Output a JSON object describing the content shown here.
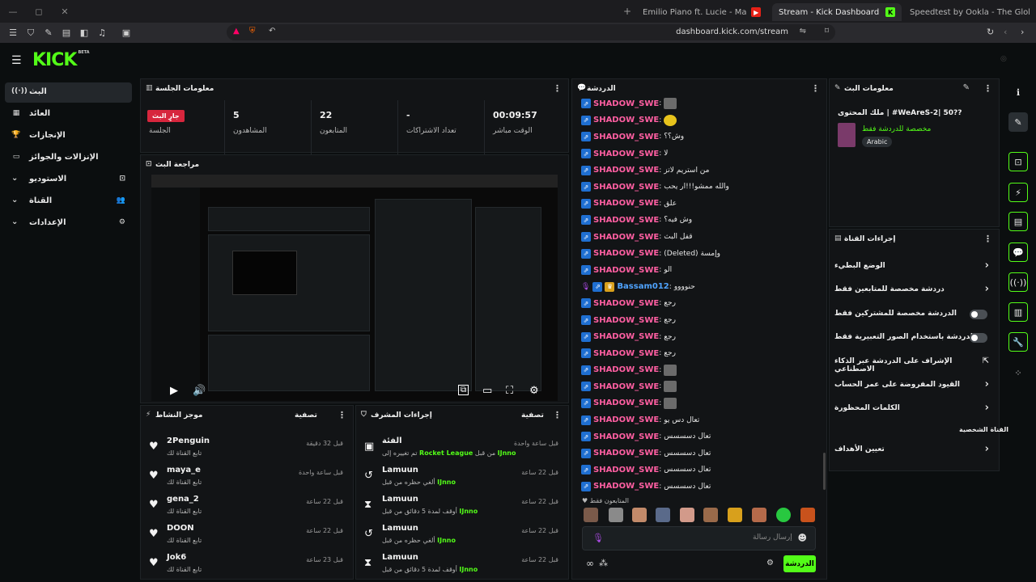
{
  "browser": {
    "tabs": [
      {
        "label": "Emilio Piano ft. Lucie - Maison - YouT",
        "fav": "▶"
      },
      {
        "label": "Stream - Kick Dashboard",
        "fav": "K"
      },
      {
        "label": "Speedtest by Ookla - The Global Broa",
        "fav": ""
      }
    ],
    "url": "dashboard.kick.com/stream"
  },
  "app": {
    "logo": "KICK",
    "beta": "BETA"
  },
  "nav": {
    "items": [
      {
        "label": "البث",
        "icon": "((·))"
      },
      {
        "label": "العائد",
        "icon": "▦"
      },
      {
        "label": "الإنجازات",
        "icon": "🏆"
      },
      {
        "label": "الإنزالات والجوائز",
        "icon": "▭"
      },
      {
        "label": "الاستوديو",
        "icon": "⊡"
      },
      {
        "label": "القناة",
        "icon": "👥"
      },
      {
        "label": "الإعدادات",
        "icon": "⚙"
      }
    ]
  },
  "session": {
    "title": "معلومات الجلسة",
    "live_badge": "جارٍ البث",
    "session_label": "الجلسة",
    "stats": [
      {
        "value": "5",
        "label": "المشاهدون"
      },
      {
        "value": "22",
        "label": "المتابعون"
      },
      {
        "value": "-",
        "label": "تعداد الاشتراكات"
      },
      {
        "value": "00:09:57",
        "label": "الوقت مباشر"
      }
    ]
  },
  "preview": {
    "title": "مراجعة البث"
  },
  "activity": {
    "title": "موجز النشاط",
    "filter": "تصفية",
    "items": [
      {
        "name": "2Penguin",
        "sub": "تابع القناة لك",
        "time": "قبل 32 دقيقة"
      },
      {
        "name": "maya_e",
        "sub": "تابع القناة لك",
        "time": "قبل ساعة واحدة"
      },
      {
        "name": "gena_2",
        "sub": "تابع القناة لك",
        "time": "قبل 22 ساعة"
      },
      {
        "name": "DOON",
        "sub": "تابع القناة لك",
        "time": "قبل 22 ساعة"
      },
      {
        "name": "Jok6",
        "sub": "تابع القناة لك",
        "time": "قبل 23 ساعة"
      }
    ]
  },
  "modactions": {
    "title": "إجراءات المشرف",
    "filter": "تصفية",
    "items": [
      {
        "icon": "▣",
        "name": "الفئة",
        "sub_pre": "تم تغييره إلى",
        "sub_hl": "Rocket League",
        "sub_mid": "من قبل",
        "sub_user": "IJnno",
        "time": "قبل ساعة واحدة"
      },
      {
        "icon": "↺",
        "name": "Lamuun",
        "sub_pre": "ألغي حظره من قبل",
        "sub_hl": "",
        "sub_mid": "",
        "sub_user": "IJnno",
        "time": "قبل 22 ساعة"
      },
      {
        "icon": "⧗",
        "name": "Lamuun",
        "sub_pre": "أوقف لمدة 5 دقائق من قبل",
        "sub_hl": "",
        "sub_mid": "",
        "sub_user": "IJnno",
        "time": "قبل 22 ساعة"
      },
      {
        "icon": "↺",
        "name": "Lamuun",
        "sub_pre": "ألغي حظره من قبل",
        "sub_hl": "",
        "sub_mid": "",
        "sub_user": "IJnno",
        "time": "قبل 22 ساعة"
      },
      {
        "icon": "⧗",
        "name": "Lamuun",
        "sub_pre": "أوقف لمدة 5 دقائق من قبل",
        "sub_hl": "",
        "sub_mid": "",
        "sub_user": "IJnno",
        "time": "قبل 22 ساعة"
      }
    ]
  },
  "chat": {
    "title": "الدردشة",
    "messages": [
      {
        "user": "SHADOW_SWE",
        "text": "",
        "emote": "gray"
      },
      {
        "user": "SHADOW_SWE",
        "text": "",
        "emote": "yellow"
      },
      {
        "user": "SHADOW_SWE",
        "text": "وش؟؟",
        "emote": ""
      },
      {
        "user": "SHADOW_SWE",
        "text": "لا",
        "emote": ""
      },
      {
        "user": "SHADOW_SWE",
        "text": "من استريم لاتز",
        "emote": ""
      },
      {
        "user": "SHADOW_SWE",
        "text": "والله ممشو!!!ار يحب",
        "emote": ""
      },
      {
        "user": "SHADOW_SWE",
        "text": "علق",
        "emote": ""
      },
      {
        "user": "SHADOW_SWE",
        "text": "وش فيه؟",
        "emote": ""
      },
      {
        "user": "SHADOW_SWE",
        "text": "قفل البث",
        "emote": ""
      },
      {
        "user": "SHADOW_SWE",
        "text": "(Deleted) وإمسة",
        "emote": ""
      },
      {
        "user": "SHADOW_SWE",
        "text": "الو",
        "emote": ""
      },
      {
        "user": "Bassam012",
        "text": "حنوووو",
        "emote": "",
        "blue": true
      },
      {
        "user": "SHADOW_SWE",
        "text": "رجع",
        "emote": ""
      },
      {
        "user": "SHADOW_SWE",
        "text": "رجع",
        "emote": ""
      },
      {
        "user": "SHADOW_SWE",
        "text": "رجع",
        "emote": ""
      },
      {
        "user": "SHADOW_SWE",
        "text": "رجع",
        "emote": ""
      },
      {
        "user": "SHADOW_SWE",
        "text": "",
        "emote": "gray"
      },
      {
        "user": "SHADOW_SWE",
        "text": "",
        "emote": "gray"
      },
      {
        "user": "SHADOW_SWE",
        "text": "",
        "emote": "gray"
      },
      {
        "user": "SHADOW_SWE",
        "text": "تعال دس يو",
        "emote": ""
      },
      {
        "user": "SHADOW_SWE",
        "text": "تعال دسسسس",
        "emote": ""
      },
      {
        "user": "SHADOW_SWE",
        "text": "تعال دسسسس",
        "emote": ""
      },
      {
        "user": "SHADOW_SWE",
        "text": "تعال دسسسس",
        "emote": ""
      },
      {
        "user": "SHADOW_SWE",
        "text": "تعال دسسسس",
        "emote": ""
      }
    ],
    "followers_only": "المتابعون فقط",
    "input_placeholder": "إرسال رسالة",
    "send_label": "الدردشة"
  },
  "stream_info": {
    "title": "معلومات البث",
    "stream_title": "ملك المحتوى | #WeAreS-2| 50??",
    "category_note": "مخصصة للدردشة فقط",
    "language": "Arabic"
  },
  "channel_actions": {
    "title": "إجراءات القناة",
    "rows": [
      {
        "label": "الوضع البطيء",
        "kind": "chevron"
      },
      {
        "label": "دردشة مخصصة للمتابعين فقط",
        "kind": "chevron"
      },
      {
        "label": "الدردشة مخصصة للمشتركين فقط",
        "kind": "toggle"
      },
      {
        "label": "الدردشة باستخدام الصور التعبيرية فقط",
        "kind": "toggle"
      },
      {
        "label": "الإشراف على الدردشة عبر الذكاء الاصطناعي",
        "kind": "ext"
      },
      {
        "label": "القيود المفروضة على عمر الحساب",
        "kind": "chevron"
      },
      {
        "label": "الكلمات المحظورة",
        "kind": "chevron"
      }
    ],
    "section": "القناة الشخصية",
    "goals": "تعيين الأهداف"
  }
}
